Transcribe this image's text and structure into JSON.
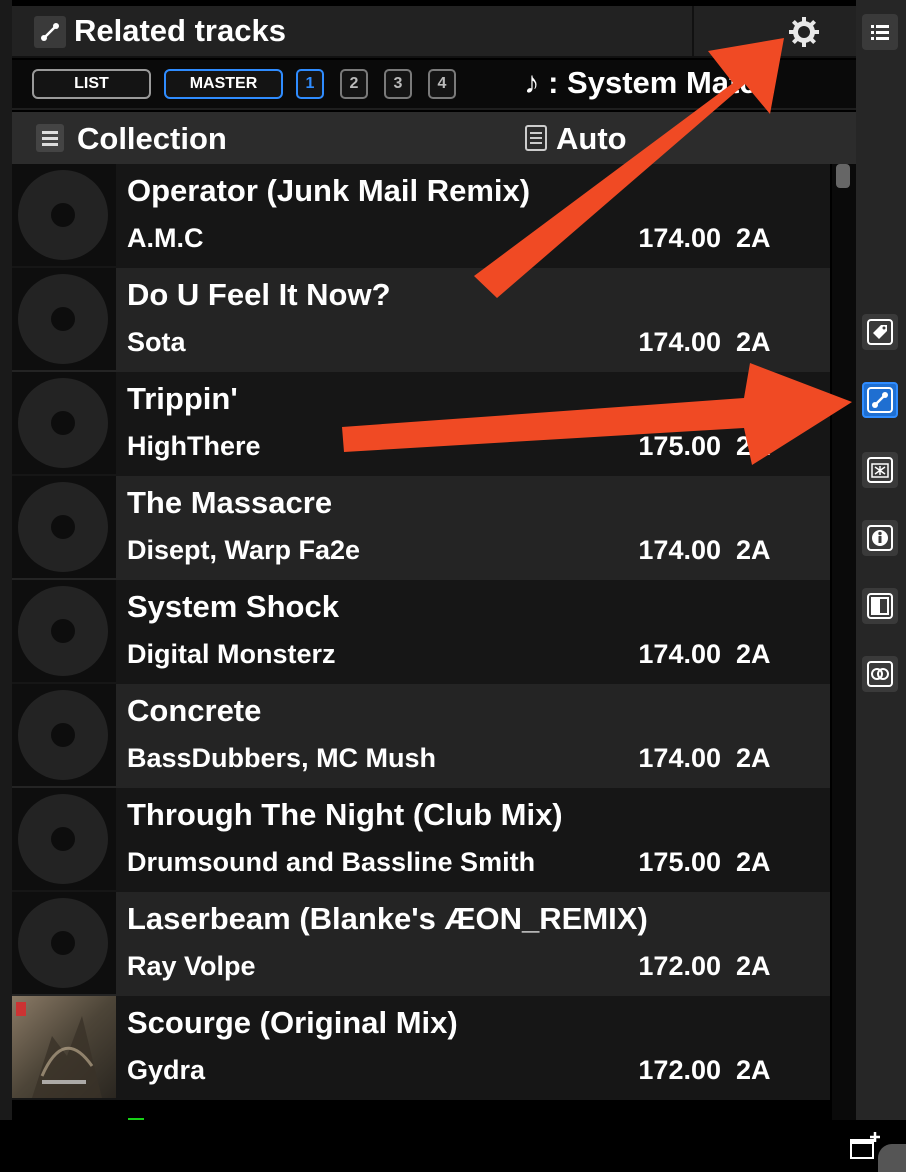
{
  "header": {
    "title": "Related tracks",
    "icon": "related-link-icon",
    "settings_icon": "gear-icon"
  },
  "filters": {
    "list_label": "LIST",
    "master_label": "MASTER",
    "decks": [
      "1",
      "2",
      "3",
      "4"
    ],
    "active_deck": "1",
    "match_label": "♪ : System Match",
    "accent_color": "#2f8cff"
  },
  "collection": {
    "title": "Collection",
    "menu_icon": "menu-icon",
    "sort_label": "Auto",
    "sort_icon": "list-doc-icon"
  },
  "tracks": [
    {
      "title": "Operator (Junk Mail Remix)",
      "artist": "A.M.C",
      "bpm": "174.00",
      "key": "2A",
      "artwork": "placeholder-disc"
    },
    {
      "title": "Do U Feel It Now?",
      "artist": "Sota",
      "bpm": "174.00",
      "key": "2A",
      "artwork": "placeholder-disc"
    },
    {
      "title": "Trippin'",
      "artist": "HighThere",
      "bpm": "175.00",
      "key": "2A",
      "artwork": "placeholder-disc"
    },
    {
      "title": "The Massacre",
      "artist": "Disept, Warp Fa2e",
      "bpm": "174.00",
      "key": "2A",
      "artwork": "placeholder-disc"
    },
    {
      "title": "System Shock",
      "artist": "Digital Monsterz",
      "bpm": "174.00",
      "key": "2A",
      "artwork": "placeholder-disc"
    },
    {
      "title": "Concrete",
      "artist": "BassDubbers, MC Mush",
      "bpm": "174.00",
      "key": "2A",
      "artwork": "placeholder-disc"
    },
    {
      "title": "Through The Night (Club Mix)",
      "artist": "Drumsound and Bassline Smith",
      "bpm": "175.00",
      "key": "2A",
      "artwork": "placeholder-disc"
    },
    {
      "title": "Laserbeam (Blanke's ÆON_REMIX)",
      "artist": "Ray Volpe",
      "bpm": "172.00",
      "key": "2A",
      "artwork": "placeholder-disc"
    },
    {
      "title": "Scourge (Original Mix)",
      "artist": "Gydra",
      "bpm": "172.00",
      "key": "2A",
      "artwork": "album-art"
    }
  ],
  "sidebar": {
    "items": [
      {
        "name": "menu-icon",
        "active": false
      },
      {
        "name": "tag-icon",
        "active": false
      },
      {
        "name": "related-link-icon",
        "active": true
      },
      {
        "name": "explorer-icon",
        "active": false
      },
      {
        "name": "info-icon",
        "active": false
      },
      {
        "name": "panel-split-icon",
        "active": false
      },
      {
        "name": "link-rings-icon",
        "active": false
      }
    ]
  },
  "footer": {
    "new_window_icon": "new-window-icon"
  },
  "annotations": {
    "arrow_color": "#f04a24"
  }
}
